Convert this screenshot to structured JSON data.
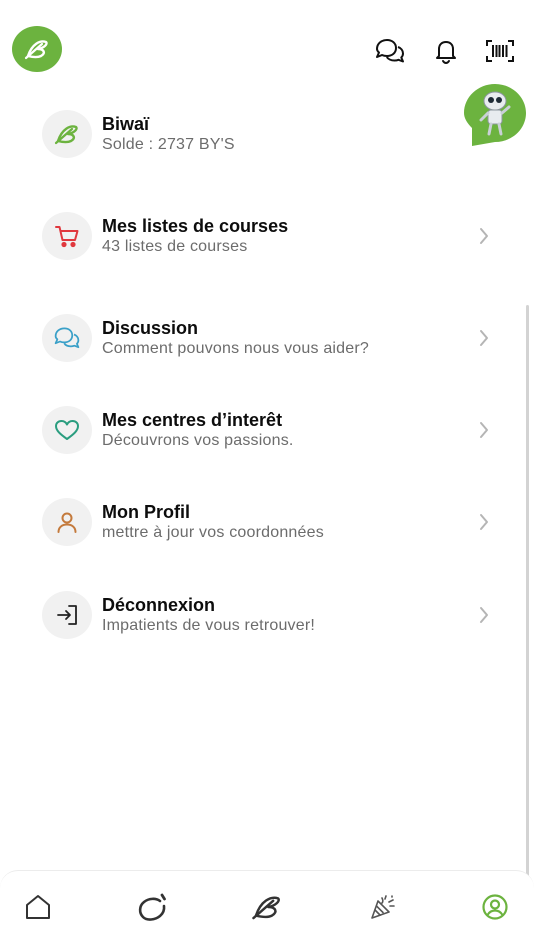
{
  "colors": {
    "brand_green": "#6cb33f",
    "cart_red": "#e0383e",
    "chat_blue": "#3aa0c8",
    "heart_teal": "#2a9d7f",
    "profile_orange": "#c47a3c",
    "text_primary": "#0d0d0d",
    "text_secondary": "#6c6c6c",
    "icon_bg": "#f1f1f1"
  },
  "header": {
    "logo_icon": "biwai-logo-icon",
    "icons": [
      "chat-icon",
      "bell-icon",
      "barcode-scan-icon"
    ],
    "assistant_icon": "robot-assistant-icon"
  },
  "menu": {
    "items": [
      {
        "title": "Biwaï",
        "subtitle": "Solde : 2737 BY'S",
        "icon": "biwai-leaf-icon",
        "has_chevron": false
      },
      {
        "title": "Mes listes de courses",
        "subtitle": "43 listes de courses",
        "icon": "cart-icon",
        "has_chevron": true
      },
      {
        "title": "Discussion",
        "subtitle": "Comment pouvons nous vous aider?",
        "icon": "chat-bubbles-icon",
        "has_chevron": true
      },
      {
        "title": "Mes centres d’interêt",
        "subtitle": "Découvrons vos passions.",
        "icon": "heart-icon",
        "has_chevron": true
      },
      {
        "title": "Mon Profil",
        "subtitle": "mettre à jour vos coordonnées",
        "icon": "user-icon",
        "has_chevron": true
      },
      {
        "title": "Déconnexion",
        "subtitle": "Impatients de vous retrouver!",
        "icon": "logout-icon",
        "has_chevron": true
      }
    ]
  },
  "tabbar": {
    "tabs": [
      "home-icon",
      "activity-icon",
      "brand-icon",
      "party-icon",
      "profile-icon"
    ],
    "active": "profile-icon"
  }
}
